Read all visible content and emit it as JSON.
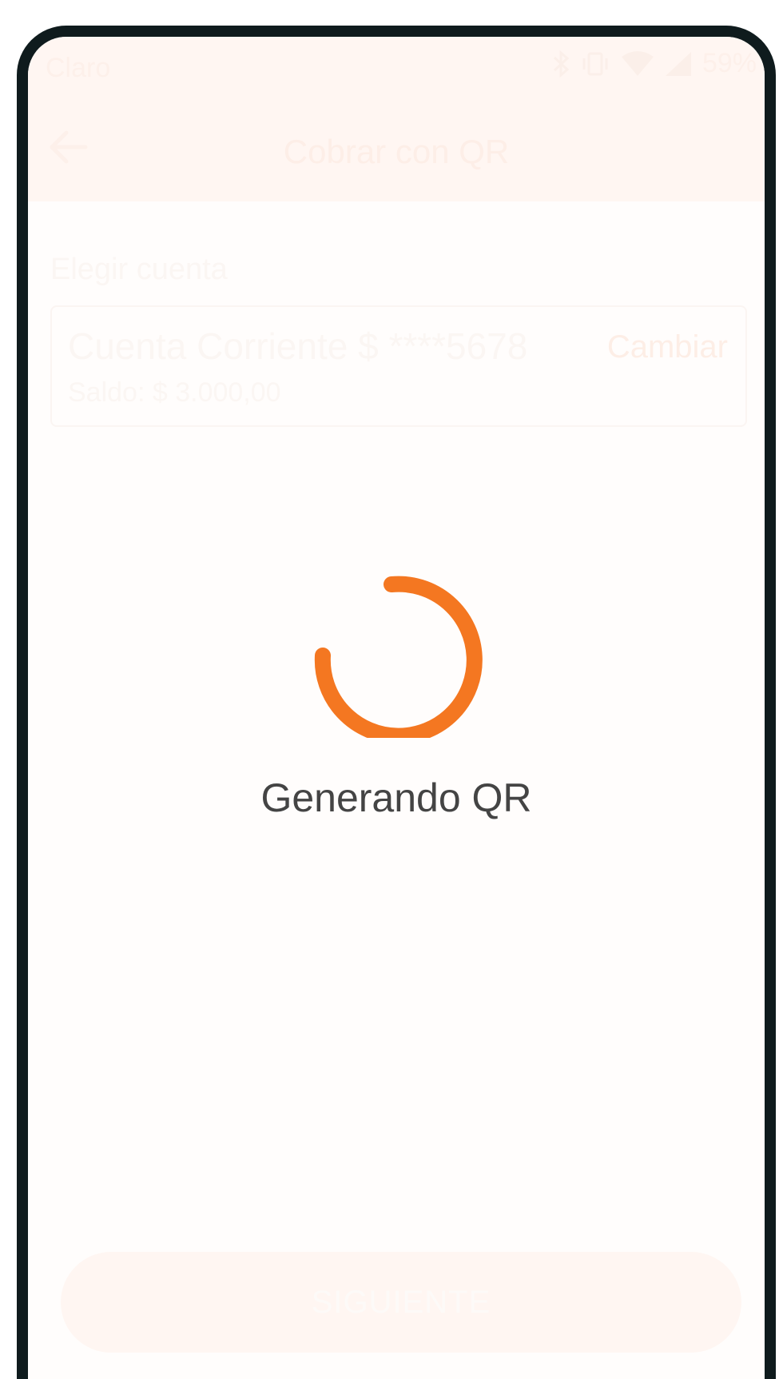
{
  "status_bar": {
    "carrier": "Claro",
    "battery_percent": "59%",
    "icons": [
      "bluetooth-icon",
      "vibrate-icon",
      "wifi-icon",
      "cell-signal-icon"
    ]
  },
  "header": {
    "back_icon": "arrow-left-icon",
    "title": "Cobrar con QR"
  },
  "account_section": {
    "label": "Elegir cuenta",
    "account_name": "Cuenta Corriente $ ****5678",
    "balance": "Saldo: $ 3.000,00",
    "change_label": "Cambiar"
  },
  "primary_button": {
    "label": "SIGUIENTE"
  },
  "loading": {
    "text": "Generando QR",
    "spinner_icon": "loading-spinner-icon"
  },
  "colors": {
    "accent": "#f47721",
    "loading_text": "#444444",
    "frame": "#0f1b1d"
  }
}
